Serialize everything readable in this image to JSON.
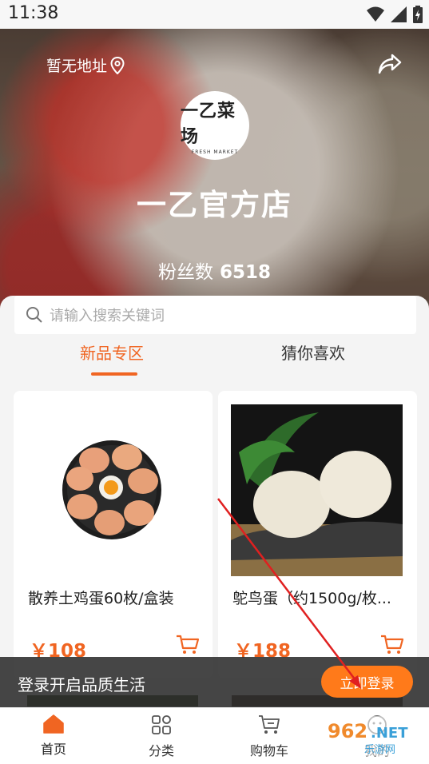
{
  "status": {
    "time": "11:38"
  },
  "header": {
    "address": "暂无地址",
    "shop_name": "一乙官方店",
    "fans_label": "粉丝数",
    "fans_count": "6518"
  },
  "logo": {
    "title": "一乙菜场",
    "subtitle": "FRESH MARKET"
  },
  "search": {
    "placeholder": "请输入搜索关键词"
  },
  "tabs": [
    {
      "label": "新品专区",
      "active": true
    },
    {
      "label": "猜你喜欢",
      "active": false
    }
  ],
  "products": [
    {
      "title": "散养土鸡蛋60枚/盒装",
      "price": "￥108"
    },
    {
      "title": "鸵鸟蛋（约1500g/枚...",
      "price": "￥188"
    }
  ],
  "login_bar": {
    "text": "登录开启品质生活",
    "button": "立即登录"
  },
  "tabbar": [
    {
      "label": "首页",
      "icon": "home-icon",
      "active": true
    },
    {
      "label": "分类",
      "icon": "category-icon",
      "active": false
    },
    {
      "label": "购物车",
      "icon": "cart-icon",
      "active": false
    },
    {
      "label": "我的",
      "icon": "user-icon",
      "active": false
    }
  ],
  "colors": {
    "accent": "#f06522",
    "login_button": "#ff7a1a"
  }
}
